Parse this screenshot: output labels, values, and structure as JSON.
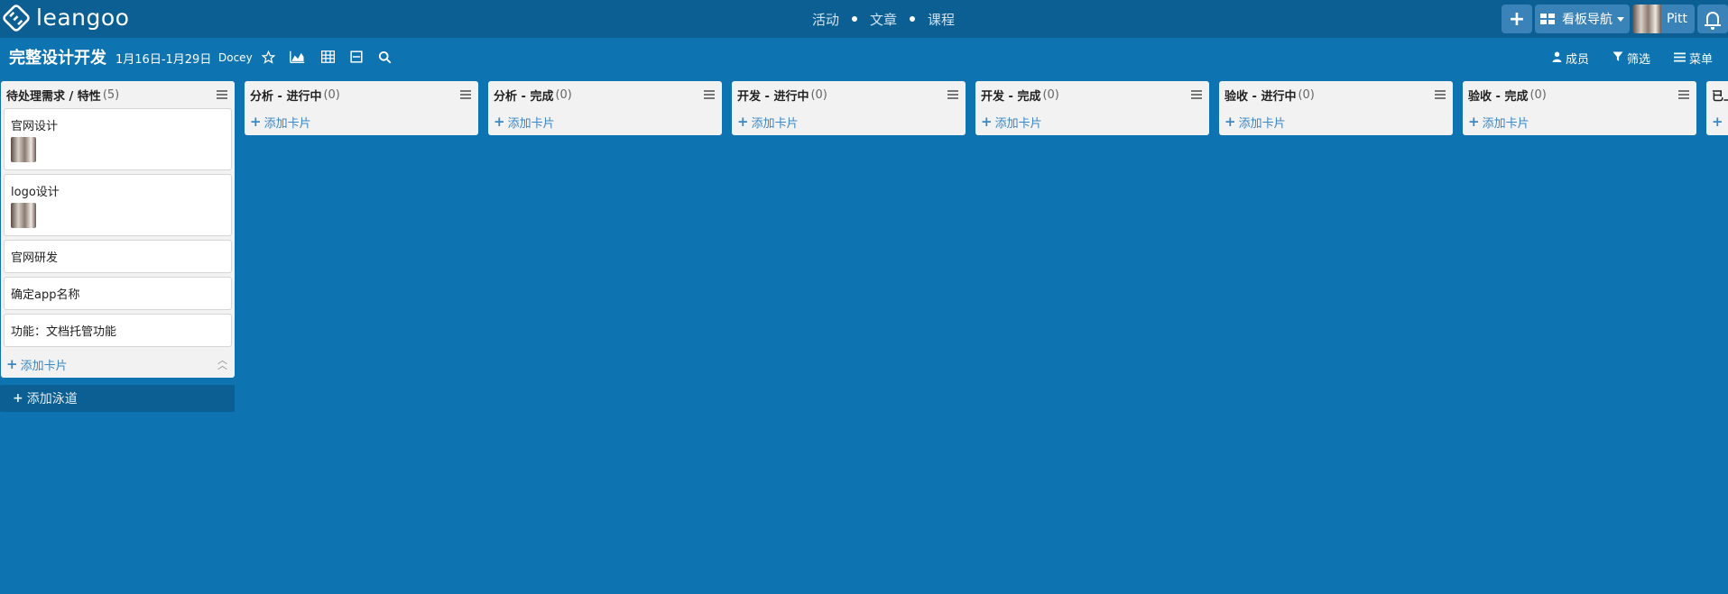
{
  "navbar": {
    "brand": "leangoo",
    "center_links": [
      "活动",
      "文章",
      "课程"
    ],
    "add_label": "+",
    "board_nav_label": "看板导航",
    "user_name": "Pitt"
  },
  "board": {
    "title": "完整设计开发",
    "dates": "1月16日-1月29日",
    "owner": "Docey",
    "members_label": "成员",
    "filter_label": "筛选",
    "menu_label": "菜单"
  },
  "lists": [
    {
      "title": "待处理需求 / 特性",
      "count": "(5)",
      "cards": [
        {
          "title": "官网设计",
          "has_avatar": true
        },
        {
          "title": "logo设计",
          "has_avatar": true
        },
        {
          "title": "官网研发",
          "has_avatar": false
        },
        {
          "title": "确定app名称",
          "has_avatar": false
        },
        {
          "title": "功能：文档托管功能",
          "has_avatar": false
        }
      ]
    },
    {
      "title": "分析 - 进行中",
      "count": "(0)",
      "cards": []
    },
    {
      "title": "分析 - 完成",
      "count": "(0)",
      "cards": []
    },
    {
      "title": "开发 - 进行中",
      "count": "(0)",
      "cards": []
    },
    {
      "title": "开发 - 完成",
      "count": "(0)",
      "cards": []
    },
    {
      "title": "验收 - 进行中",
      "count": "(0)",
      "cards": []
    },
    {
      "title": "验收 - 完成",
      "count": "(0)",
      "cards": []
    },
    {
      "title": "已上线",
      "count": "",
      "cards": []
    }
  ],
  "add_card_label": "添加卡片",
  "add_lane_label": "添加泳道",
  "colors": {
    "background": "#0e74b1",
    "navbar": "#0b5f93",
    "link_blue": "#3a86c5"
  }
}
